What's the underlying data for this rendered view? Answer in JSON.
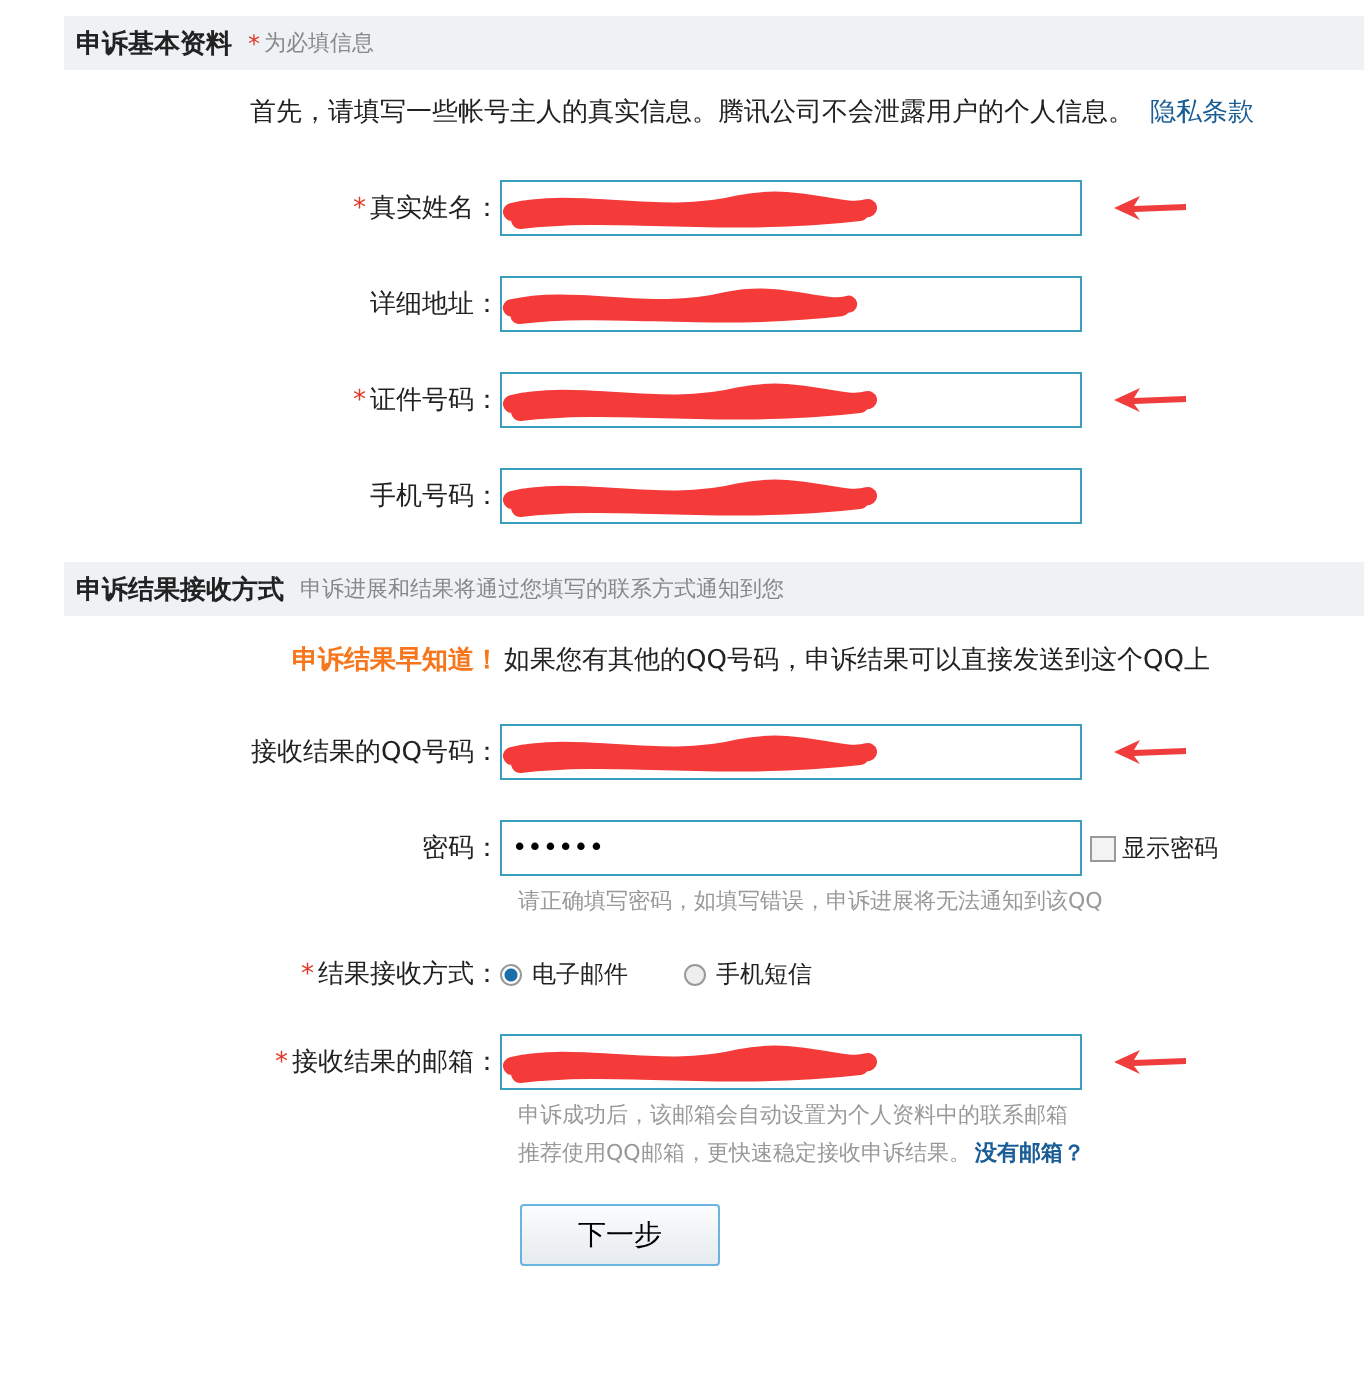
{
  "sections": [
    {
      "title": "申诉基本资料",
      "note_mark": "*",
      "note": "为必填信息",
      "intro": {
        "text": "首先，请填写一些帐号主人的真实信息。腾讯公司不会泄露用户的个人信息。",
        "link": "隐私条款"
      },
      "fields": [
        {
          "kind": "text",
          "mark": "*",
          "label": "真实姓名：",
          "redacted": true,
          "arrow": true
        },
        {
          "kind": "text",
          "label": "详细地址：",
          "redacted": true,
          "arrow": false
        },
        {
          "kind": "text",
          "mark": "*",
          "label": "证件号码：",
          "redacted": true,
          "arrow": true
        },
        {
          "kind": "text",
          "label": "手机号码：",
          "redacted": true,
          "arrow": false
        }
      ]
    },
    {
      "title": "申诉结果接收方式",
      "subtitle": "申诉进展和结果将通过您填写的联系方式通知到您",
      "intro": {
        "highlight": "申诉结果早知道！",
        "text": "如果您有其他的QQ号码，申诉结果可以直接发送到这个QQ上"
      },
      "fields": [
        {
          "kind": "text",
          "label": "接收结果的QQ号码：",
          "redacted": true,
          "arrow": true
        },
        {
          "kind": "password",
          "label": "密码：",
          "value": "••••••",
          "checkbox": {
            "label": "显示密码",
            "checked": false
          },
          "hints": [
            {
              "text": "请正确填写密码，如填写错误，申诉进展将无法通知到该QQ"
            }
          ]
        },
        {
          "kind": "radio",
          "mark": "*",
          "label": "结果接收方式：",
          "options": [
            {
              "label": "电子邮件",
              "selected": true
            },
            {
              "label": "手机短信",
              "selected": false
            }
          ]
        },
        {
          "kind": "text",
          "mark": "*",
          "label": "接收结果的邮箱：",
          "redacted": true,
          "arrow": true,
          "hints": [
            {
              "text": "申诉成功后，该邮箱会自动设置为个人资料中的联系邮箱"
            },
            {
              "text": "推荐使用QQ邮箱，更快速稳定接收申诉结果。",
              "link": "没有邮箱？"
            }
          ]
        }
      ]
    }
  ],
  "button": "下一步"
}
